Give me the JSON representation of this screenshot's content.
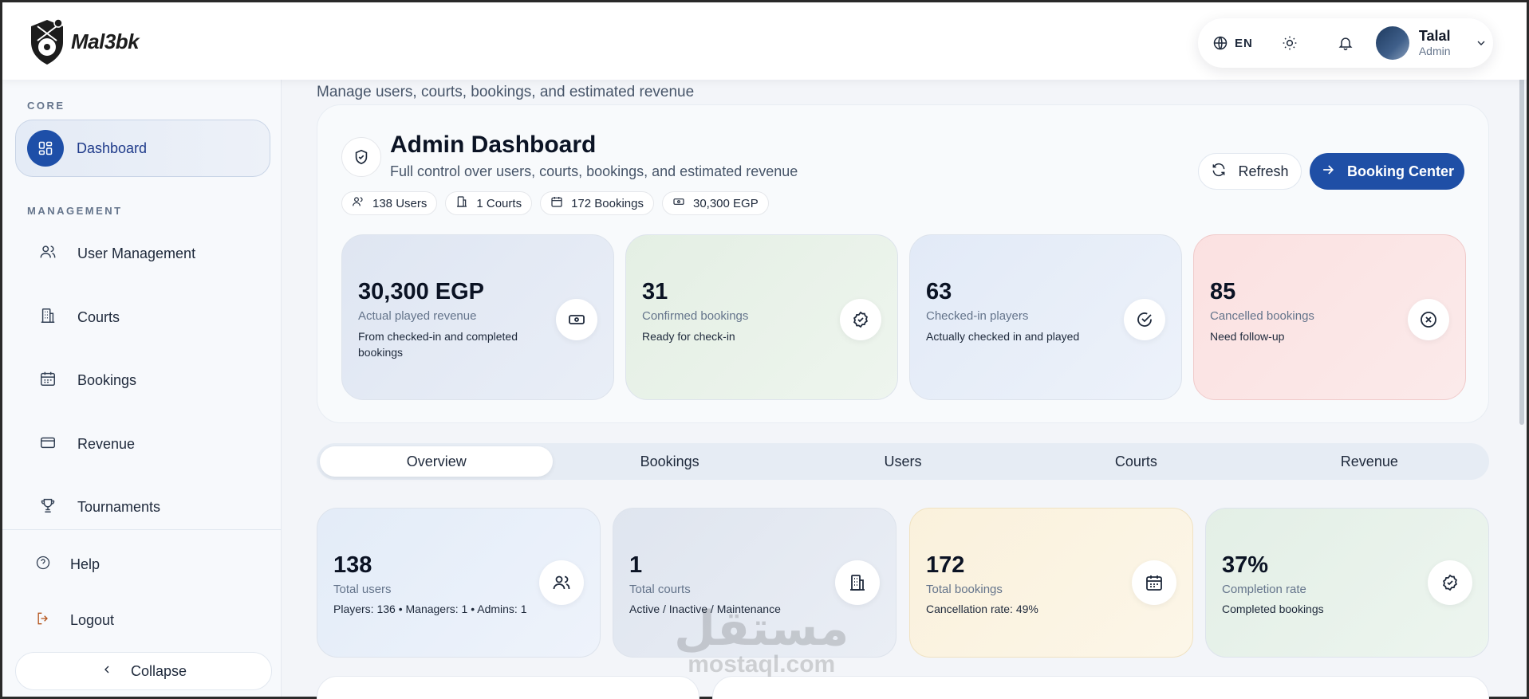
{
  "brand": {
    "name": "Mal3bk"
  },
  "header": {
    "language": "EN",
    "user": {
      "name": "Talal",
      "role": "Admin"
    }
  },
  "sidebar": {
    "core_label": "CORE",
    "management_label": "MANAGEMENT",
    "items": [
      {
        "label": "Dashboard",
        "icon": "grid-icon",
        "active": true
      },
      {
        "label": "User Management",
        "icon": "users-icon"
      },
      {
        "label": "Courts",
        "icon": "building-icon"
      },
      {
        "label": "Bookings",
        "icon": "calendar-icon"
      },
      {
        "label": "Revenue",
        "icon": "card-icon"
      },
      {
        "label": "Tournaments",
        "icon": "trophy-icon"
      }
    ],
    "help": "Help",
    "logout": "Logout",
    "collapse": "Collapse"
  },
  "page": {
    "top_subtitle": "Manage users, courts, bookings, and estimated revenue",
    "title": "Admin Dashboard",
    "subtitle": "Full control over users, courts, bookings, and estimated revenue",
    "chips": [
      "138 Users",
      "1 Courts",
      "172 Bookings",
      "30,300 EGP"
    ],
    "refresh": "Refresh",
    "booking_center": "Booking Center"
  },
  "stats": [
    {
      "value": "30,300 EGP",
      "label": "Actual played revenue",
      "desc": "From checked-in and completed bookings",
      "icon": "money-icon",
      "color": "#e3e9f4"
    },
    {
      "value": "31",
      "label": "Confirmed bookings",
      "desc": "Ready for check-in",
      "icon": "badge-check-icon",
      "color": "#e6f1e6"
    },
    {
      "value": "63",
      "label": "Checked-in players",
      "desc": "Actually checked in and played",
      "icon": "check-circle-icon",
      "color": "#e5edf8"
    },
    {
      "value": "85",
      "label": "Cancelled bookings",
      "desc": "Need follow-up",
      "icon": "x-circle-icon",
      "color": "#fbe4e4"
    }
  ],
  "tabs": [
    "Overview",
    "Bookings",
    "Users",
    "Courts",
    "Revenue"
  ],
  "kpis": [
    {
      "value": "138",
      "label": "Total users",
      "desc": "Players: 136 • Managers: 1 • Admins: 1",
      "icon": "users-icon",
      "color": "#e8eff9"
    },
    {
      "value": "1",
      "label": "Total courts",
      "desc": "Active / Inactive / Maintenance",
      "icon": "building-icon",
      "color": "#e4e9f2"
    },
    {
      "value": "172",
      "label": "Total bookings",
      "desc": "Cancellation rate: 49%",
      "icon": "calendar-icon",
      "color": "#fbf4e2"
    },
    {
      "value": "37%",
      "label": "Completion rate",
      "desc": "Completed bookings",
      "icon": "badge-check-icon",
      "color": "#e7f1ea"
    }
  ],
  "watermark": {
    "arabic": "مستقل",
    "latin": "mostaql.com"
  },
  "colors": {
    "primary": "#1f4fa6",
    "text": "#0b1324",
    "muted": "#64748b"
  }
}
